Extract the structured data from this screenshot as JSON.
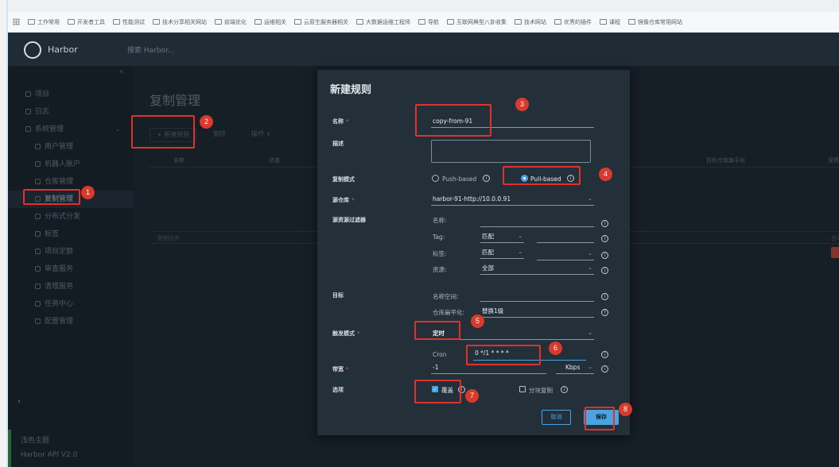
{
  "browser": {
    "bookmarks": [
      "工作常用",
      "开发者工具",
      "性能测试",
      "技术分享相关网站",
      "前端优化",
      "运维相关",
      "云原生服务器相关",
      "大数据运维工程师",
      "导航",
      "互联网典型八卦收集",
      "技术网站",
      "优秀的插件",
      "课程",
      "镜像仓库常用网站"
    ]
  },
  "header": {
    "logo_text": "Harbor",
    "search_placeholder": "搜索 Harbor..."
  },
  "sidebar": {
    "collapse": "«",
    "items": [
      {
        "label": "项目"
      },
      {
        "label": "日志"
      },
      {
        "label": "系统管理"
      },
      {
        "label": "用户管理"
      },
      {
        "label": "机器人账户"
      },
      {
        "label": "仓库管理"
      },
      {
        "label": "复制管理"
      },
      {
        "label": "分布式分发"
      },
      {
        "label": "标签"
      },
      {
        "label": "项目定额"
      },
      {
        "label": "审查服务"
      },
      {
        "label": "清理服务"
      },
      {
        "label": "任务中心"
      },
      {
        "label": "配置管理"
      }
    ],
    "expand": "›",
    "bottom": {
      "theme": "浅色主题",
      "api": "Harbor API V2.0"
    }
  },
  "main": {
    "title": "复制管理",
    "new_rule_btn": "+ 新建规则",
    "delete_btn": "删除",
    "actions_btn": "操作 ∨",
    "columns": [
      "名称",
      "状态",
      "目标仓库扁平化",
      "源资源"
    ],
    "footer_left": "复制任务",
    "footer_right": "自动"
  },
  "modal": {
    "title": "新建规则",
    "name_label": "名称",
    "name_value": "copy-from-91",
    "desc_label": "描述",
    "mode_label": "复制模式",
    "push_label": "Push-based",
    "pull_label": "Pull-based",
    "source_label": "源仓库",
    "source_value": "harbor-91-http://10.0.0.91",
    "filter_label": "源资源过滤器",
    "filter_name": "名称:",
    "filter_tag": "Tag:",
    "filter_tag_match": "匹配",
    "filter_label2": "标签:",
    "filter_label_match": "匹配",
    "filter_resource": "资源:",
    "filter_resource_value": "全部",
    "target_label": "目标",
    "target_ns": "名称空间:",
    "target_flatten": "仓库扁平化:",
    "target_flatten_value": "替换1级",
    "trigger_label": "触发模式",
    "trigger_value": "定时",
    "cron_label": "Cron",
    "cron_value": "0 */1 * * * *",
    "bandwidth_label": "带宽",
    "bandwidth_value": "-1",
    "bandwidth_unit": "Kbps",
    "options_label": "选项",
    "override_label": "覆盖",
    "copy_label": "分块复制",
    "cancel_btn": "取消",
    "save_btn": "保存",
    "required_mark": "*"
  },
  "annotations": [
    "1",
    "2",
    "3",
    "4",
    "5",
    "6",
    "7",
    "8"
  ],
  "colors": {
    "accent": "#4ba4e0",
    "marker": "#e0322d"
  }
}
